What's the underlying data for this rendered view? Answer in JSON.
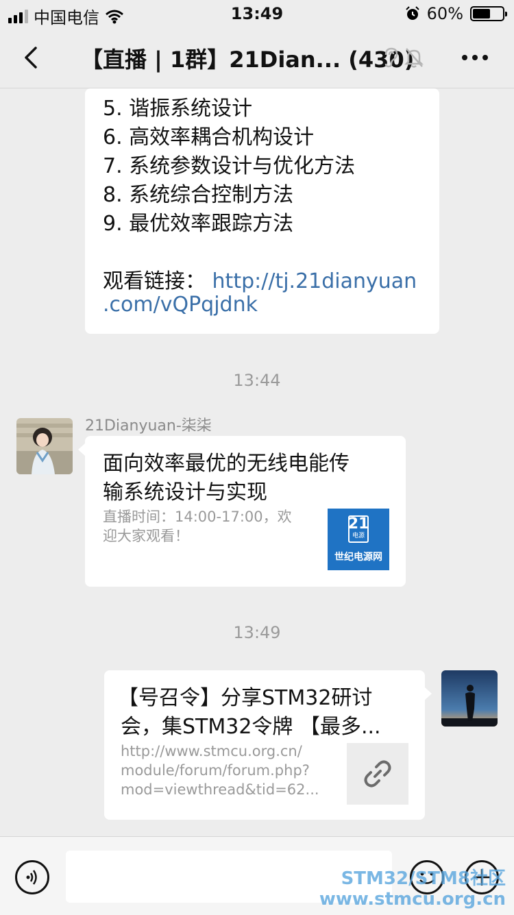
{
  "status": {
    "carrier": "中国电信",
    "time": "13:49",
    "battery": "60%",
    "battery_level": 0.6,
    "icons": [
      "signal-icon",
      "wifi-icon",
      "alarm-icon",
      "battery-icon"
    ]
  },
  "header": {
    "title": "【直播 | 1群】21Dian... (430)",
    "icons": [
      "back-icon",
      "ear-icon",
      "mute-bell-icon",
      "more-icon"
    ]
  },
  "messages": {
    "m1": {
      "lines": [
        "5. 谐振系统设计",
        "6. 高效率耦合机构设计",
        "7. 系统参数设计与优化方法",
        "8. 系统综合控制方法",
        "9. 最优效率跟踪方法"
      ],
      "link_label": "观看链接：",
      "link_part1": "http://tj.21dianyuan",
      "link_part2": ".com/vQPqjdnk"
    },
    "time1": "13:44",
    "m2": {
      "sender": "21Dianyuan-柒柒",
      "title_line1": "面向效率最优的无线电能传",
      "title_line2": "输系统设计与实现",
      "desc_line1": "直播时间：14:00-17:00，欢",
      "desc_line2": "迎大家观看！",
      "logo_number": "21",
      "logo_small": "电源",
      "logo_text": "世纪电源网"
    },
    "time2": "13:49",
    "m3": {
      "title_line1": "【号召令】分享STM32研讨",
      "title_line2": "会，集STM32令牌 【最多...",
      "url_line1": "http://www.stmcu.org.cn/",
      "url_line2": "module/forum/forum.php?",
      "url_line3": "mod=viewthread&tid=62..."
    }
  },
  "input": {
    "icons": [
      "voice-icon",
      "emoji-icon",
      "plus-icon"
    ]
  },
  "watermark": {
    "line1": "STM32/STM8社区",
    "line2": "www.stmcu.org.cn"
  }
}
